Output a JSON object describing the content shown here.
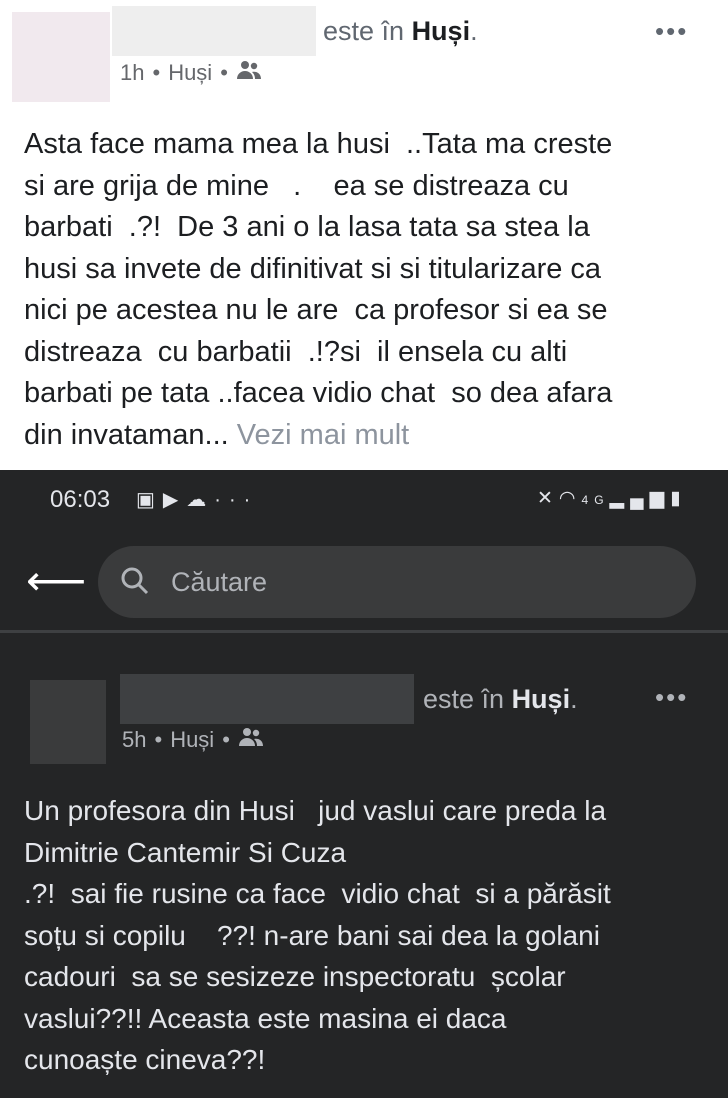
{
  "post1": {
    "checkin_prefix": "este în ",
    "location": "Huși",
    "checkin_suffix": ".",
    "time": "1h",
    "meta_place": "Huși",
    "dot": "•",
    "more": "•••",
    "text": "Asta face mama mea la husi  ..Tata ma creste\nsi are grija de mine   .    ea se distreaza cu\nbarbati  .?!  De 3 ani o la lasa tata sa stea la\nhusi sa invete de difinitivat si si titularizare ca\nnici pe acestea nu le are  ca profesor si ea se\ndistreaza  cu barbatii  .!?si  il ensela cu alti\nbarbati pe tata ..facea vidio chat  so dea afara\ndin invataman...",
    "see_more": "Vezi mai mult"
  },
  "status_bar": {
    "time": "06:03",
    "icons_left": [
      "gallery-icon",
      "play-icon",
      "weather-icon",
      "more-dots-icon"
    ],
    "icons_right": [
      "mute-icon",
      "wifi-icon",
      "4g-icon",
      "signal-icon",
      "battery-icon"
    ]
  },
  "search": {
    "placeholder": "Căutare"
  },
  "post2": {
    "checkin_prefix": "este în ",
    "location": "Huși",
    "checkin_suffix": ".",
    "time": "5h",
    "meta_place": "Huși",
    "dot": "•",
    "more": "•••",
    "text": "Un profesora din Husi   jud vaslui care preda la\nDimitrie Cantemir Si Cuza\n.?!  sai fie rusine ca face  vidio chat  si a părăsit\nsoțu si copilu    ??! n-are bani sai dea la golani\ncadouri  sa se sesizeze inspectoratu  școlar\nvaslui??!! Aceasta este masina ei daca\ncunoaște cineva??!"
  },
  "colors": {
    "light_bg": "#ffffff",
    "dark_bg": "#242526",
    "see_more": "#8d949e",
    "search_bg": "#3a3b3c"
  }
}
